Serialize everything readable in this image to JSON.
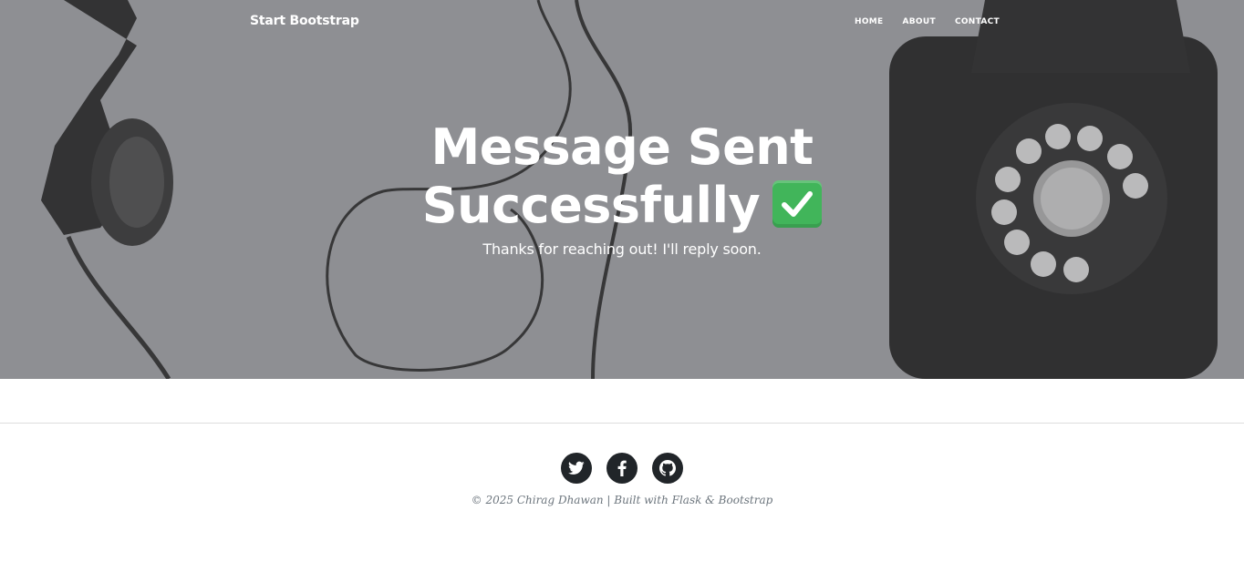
{
  "navbar": {
    "brand": "Start Bootstrap",
    "links": [
      "HOME",
      "ABOUT",
      "CONTACT"
    ]
  },
  "hero": {
    "title_line1": "Message Sent",
    "title_line2": "Successfully",
    "title_emoji": "check-mark-button-icon",
    "subtitle": "Thanks for reaching out! I'll reply soon."
  },
  "footer": {
    "social_icons": [
      "twitter-icon",
      "facebook-icon",
      "github-icon"
    ],
    "copyright": "© 2025 Chirag Dhawan | Built with Flask & Bootstrap"
  },
  "colors": {
    "hero_overlay": "#8e8f93",
    "social_button": "#212529",
    "copyright_text": "#6c757d",
    "check_green": "#41b55a"
  }
}
